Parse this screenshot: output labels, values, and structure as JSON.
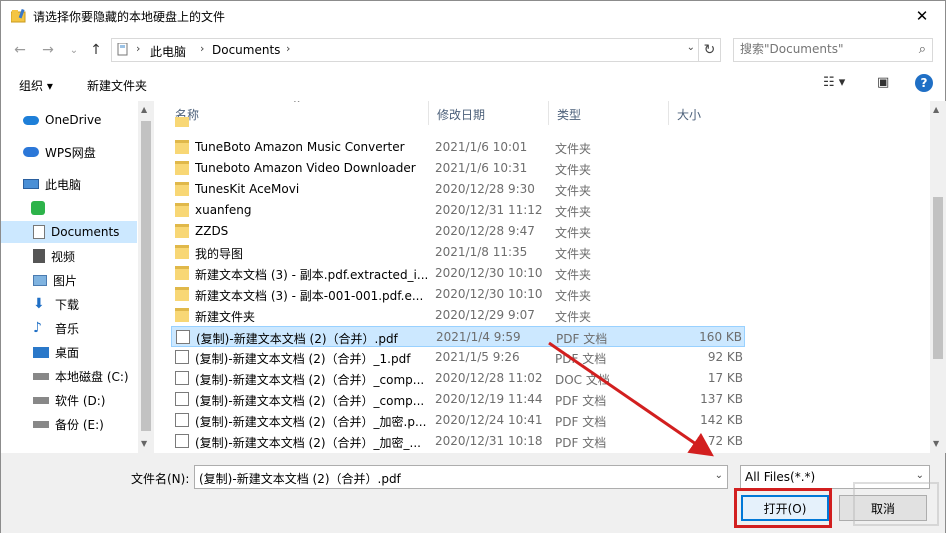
{
  "title": "请选择你要隐藏的本地硬盘上的文件",
  "close_glyph": "✕",
  "address": {
    "crumbs": [
      "此电脑",
      "Documents"
    ],
    "search_placeholder": "搜索\"Documents\""
  },
  "toolbar": {
    "organize": "组织 ▾",
    "new_folder": "新建文件夹"
  },
  "sidebar": {
    "items": [
      {
        "label": "OneDrive",
        "icon": "cloud-icon"
      },
      {
        "label": "WPS网盘",
        "icon": "cloud-icon"
      },
      {
        "label": "此电脑",
        "icon": "computer-icon"
      },
      {
        "label": "",
        "icon": "app-icon"
      },
      {
        "label": "Documents",
        "icon": "document-icon"
      },
      {
        "label": "视频",
        "icon": "video-icon"
      },
      {
        "label": "图片",
        "icon": "picture-icon"
      },
      {
        "label": "下载",
        "icon": "download-icon"
      },
      {
        "label": "音乐",
        "icon": "music-icon"
      },
      {
        "label": "桌面",
        "icon": "desktop-icon"
      },
      {
        "label": "本地磁盘 (C:)",
        "icon": "drive-icon"
      },
      {
        "label": "软件 (D:)",
        "icon": "drive-icon"
      },
      {
        "label": "备份 (E:)",
        "icon": "drive-icon"
      }
    ]
  },
  "columns": {
    "name": "名称",
    "date": "修改日期",
    "type": "类型",
    "size": "大小"
  },
  "files": [
    {
      "name": "TuneBoto Amazon Music Converter",
      "date": "2021/1/6 10:01",
      "type": "文件夹",
      "size": "",
      "kind": "folder"
    },
    {
      "name": "Tuneboto Amazon Video Downloader",
      "date": "2021/1/6 10:31",
      "type": "文件夹",
      "size": "",
      "kind": "folder"
    },
    {
      "name": "TunesKit AceMovi",
      "date": "2020/12/28 9:30",
      "type": "文件夹",
      "size": "",
      "kind": "folder"
    },
    {
      "name": "xuanfeng",
      "date": "2020/12/31 11:12",
      "type": "文件夹",
      "size": "",
      "kind": "folder"
    },
    {
      "name": "ZZDS",
      "date": "2020/12/28 9:47",
      "type": "文件夹",
      "size": "",
      "kind": "folder"
    },
    {
      "name": "我的导图",
      "date": "2021/1/8 11:35",
      "type": "文件夹",
      "size": "",
      "kind": "folder"
    },
    {
      "name": "新建文本文档 (3) - 副本.pdf.extracted_i...",
      "date": "2020/12/30 10:10",
      "type": "文件夹",
      "size": "",
      "kind": "folder"
    },
    {
      "name": "新建文本文档 (3) - 副本-001-001.pdf.e...",
      "date": "2020/12/30 10:10",
      "type": "文件夹",
      "size": "",
      "kind": "folder"
    },
    {
      "name": "新建文件夹",
      "date": "2020/12/29 9:07",
      "type": "文件夹",
      "size": "",
      "kind": "folder"
    },
    {
      "name": "(复制)-新建文本文档 (2)（合并）.pdf",
      "date": "2021/1/4 9:59",
      "type": "PDF 文档",
      "size": "160 KB",
      "kind": "pdf",
      "selected": true
    },
    {
      "name": "(复制)-新建文本文档 (2)（合并）_1.pdf",
      "date": "2021/1/5 9:26",
      "type": "PDF 文档",
      "size": "92 KB",
      "kind": "pdf"
    },
    {
      "name": "(复制)-新建文本文档 (2)（合并）_comp...",
      "date": "2020/12/28 11:02",
      "type": "DOC 文档",
      "size": "17 KB",
      "kind": "doc"
    },
    {
      "name": "(复制)-新建文本文档 (2)（合并）_comp...",
      "date": "2020/12/19 11:44",
      "type": "PDF 文档",
      "size": "137 KB",
      "kind": "pdf"
    },
    {
      "name": "(复制)-新建文本文档 (2)（合并）_加密.p...",
      "date": "2020/12/24 10:41",
      "type": "PDF 文档",
      "size": "142 KB",
      "kind": "pdf"
    },
    {
      "name": "(复制)-新建文本文档 (2)（合并）_加密_...",
      "date": "2020/12/31 10:18",
      "type": "PDF 文档",
      "size": "72 KB",
      "kind": "pdf"
    }
  ],
  "footer": {
    "filename_label": "文件名(N):",
    "filename_value": "(复制)-新建文本文档 (2)（合并）.pdf",
    "filter_value": "All Files(*.*)",
    "open": "打开(O)",
    "cancel": "取消"
  },
  "colors": {
    "selection": "#cce8ff",
    "annotation": "#d21f1f",
    "accent": "#0078d7"
  }
}
